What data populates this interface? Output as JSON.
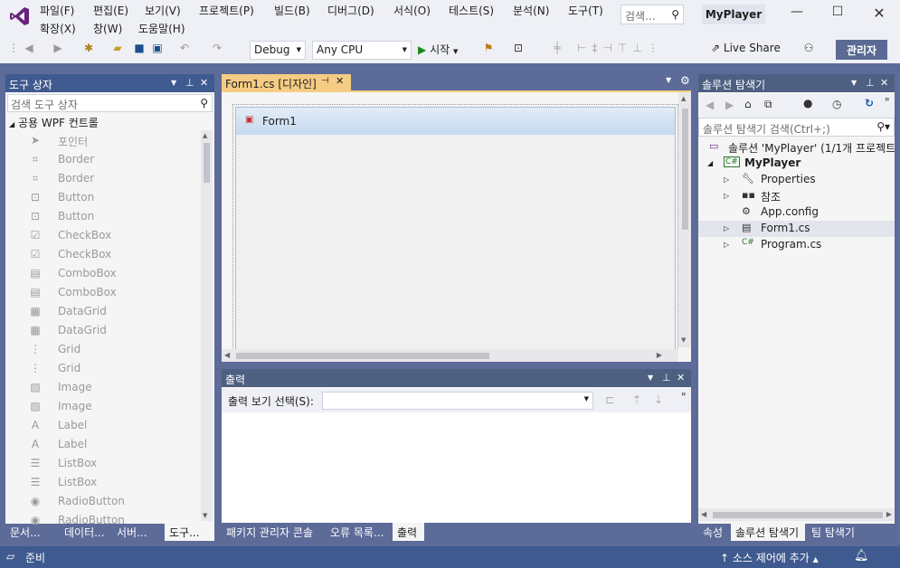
{
  "titlebar": {
    "menus_row1": [
      "파일(F)",
      "편집(E)",
      "보기(V)",
      "프로젝트(P)",
      "빌드(B)",
      "디버그(D)",
      "서식(O)",
      "테스트(S)",
      "분석(N)",
      "도구(T)"
    ],
    "menus_row2": [
      "확장(X)",
      "창(W)",
      "도움말(H)"
    ],
    "search_placeholder": "검색...",
    "app_name": "MyPlayer"
  },
  "toolbar": {
    "config": "Debug",
    "platform": "Any CPU",
    "start_label": "시작",
    "live_share": "Live Share",
    "admin": "관리자"
  },
  "toolbox": {
    "title": "도구 상자",
    "search_placeholder": "검색 도구 상자",
    "group": "공용 WPF 컨트롤",
    "items": [
      "포인터",
      "Border",
      "Border",
      "Button",
      "Button",
      "CheckBox",
      "CheckBox",
      "ComboBox",
      "ComboBox",
      "DataGrid",
      "DataGrid",
      "Grid",
      "Grid",
      "Image",
      "Image",
      "Label",
      "Label",
      "ListBox",
      "ListBox",
      "RadioButton",
      "RadioButton"
    ],
    "tabs": [
      "문서...",
      "데이터...",
      "서버...",
      "도구..."
    ]
  },
  "designer": {
    "tab_title": "Form1.cs [디자인]",
    "form_title": "Form1"
  },
  "output": {
    "title": "출력",
    "show_label": "출력 보기 선택(S):",
    "tabs": [
      "패키지 관리자 콘솔",
      "오류 목록...",
      "출력"
    ]
  },
  "solution": {
    "title": "솔루션 탐색기",
    "search_placeholder": "솔루션 탐색기 검색(Ctrl+;)",
    "root": "솔루션 'MyPlayer' (1/1개 프로젝트",
    "project": "MyPlayer",
    "nodes": [
      "Properties",
      "참조",
      "App.config",
      "Form1.cs",
      "Program.cs"
    ],
    "tabs": [
      "속성",
      "솔루션 탐색기",
      "팀 탐색기"
    ]
  },
  "statusbar": {
    "status": "준비",
    "source_control": "소스 제어에 추가"
  },
  "colors": {
    "accent": "#68217a",
    "panel_header_active": "#3f5a8f",
    "tab_active": "#f5cc84",
    "chrome": "#5d6b99"
  }
}
